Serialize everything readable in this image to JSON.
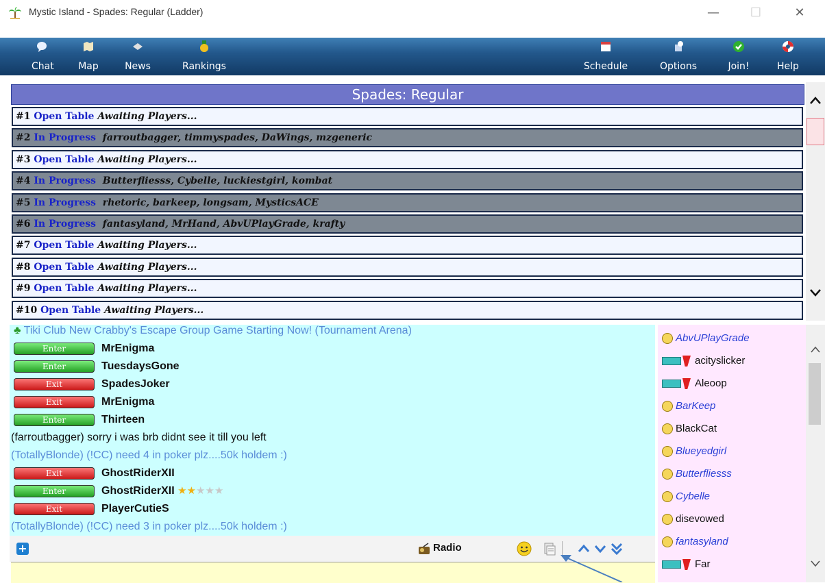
{
  "window": {
    "title": "Mystic Island - Spades: Regular (Ladder)",
    "minimize_glyph": "—",
    "maximize_glyph": "☐",
    "close_glyph": "✕"
  },
  "toolbar": {
    "left_items": [
      {
        "label": "Chat",
        "icon": "chat-bubble-icon"
      },
      {
        "label": "Map",
        "icon": "map-icon"
      },
      {
        "label": "News",
        "icon": "news-icon"
      },
      {
        "label": "Rankings",
        "icon": "medal-icon"
      }
    ],
    "right_items": [
      {
        "label": "Schedule",
        "icon": "calendar-icon"
      },
      {
        "label": "Options",
        "icon": "options-icon"
      },
      {
        "label": "Join!",
        "icon": "check-icon"
      },
      {
        "label": "Help",
        "icon": "lifebuoy-icon"
      }
    ]
  },
  "room": {
    "header": "Spades: Regular",
    "tables": [
      {
        "num": "#1",
        "status": "Open Table",
        "players": "Awaiting Players...",
        "state": "open"
      },
      {
        "num": "#2",
        "status": "In Progress",
        "players": "farroutbagger, timmyspades, DaWings, mzgeneric",
        "state": "prog"
      },
      {
        "num": "#3",
        "status": "Open Table",
        "players": "Awaiting Players...",
        "state": "open"
      },
      {
        "num": "#4",
        "status": "In Progress",
        "players": "Butterfliesss, Cybelle, luckiestgirl, kombat",
        "state": "prog"
      },
      {
        "num": "#5",
        "status": "In Progress",
        "players": "rhetoric, barkeep, longsam, MysticsACE",
        "state": "prog"
      },
      {
        "num": "#6",
        "status": "In Progress",
        "players": "fantasyland, MrHand, AbvUPlayGrade, krafty",
        "state": "prog"
      },
      {
        "num": "#7",
        "status": "Open Table",
        "players": "Awaiting Players...",
        "state": "open"
      },
      {
        "num": "#8",
        "status": "Open Table",
        "players": "Awaiting Players...",
        "state": "open"
      },
      {
        "num": "#9",
        "status": "Open Table",
        "players": "Awaiting Players...",
        "state": "open"
      },
      {
        "num": "#10",
        "status": "Open Table",
        "players": "Awaiting Players...",
        "state": "open"
      }
    ]
  },
  "chat": {
    "announcement": "Tiki Club  New Crabby's Escape Group Game Starting Now! (Tournament Arena)",
    "enter_label": "Enter",
    "exit_label": "Exit",
    "lines": [
      {
        "type": "enter",
        "name": "MrEnigma"
      },
      {
        "type": "enter",
        "name": "TuesdaysGone"
      },
      {
        "type": "exit",
        "name": "SpadesJoker"
      },
      {
        "type": "exit",
        "name": "MrEnigma"
      },
      {
        "type": "enter",
        "name": "Thirteen"
      },
      {
        "type": "msg",
        "text": "(farroutbagger) sorry i was brb didnt see it till you left",
        "color": "dark"
      },
      {
        "type": "msg",
        "text": "(TotallyBlonde) (!CC) need 4 in poker plz....50k holdem :)",
        "color": "blue"
      },
      {
        "type": "exit",
        "name": "GhostRiderXII"
      },
      {
        "type": "enter",
        "name": "GhostRiderXII",
        "stars": 2,
        "stars_total": 5
      },
      {
        "type": "exit",
        "name": "PlayerCutieS"
      },
      {
        "type": "msg",
        "text": "(TotallyBlonde) (!CC) need 3 in poker plz....50k holdem :)",
        "color": "blue"
      }
    ],
    "toolbar": {
      "radio_label": "Radio",
      "plus_glyph": "+"
    },
    "input_value": ""
  },
  "users": [
    {
      "name": "AbvUPlayGrade",
      "style": "italic",
      "icon": "face"
    },
    {
      "name": "acityslicker",
      "style": "normal",
      "icon": "badge"
    },
    {
      "name": "Aleoop",
      "style": "normal",
      "icon": "badge"
    },
    {
      "name": "BarKeep",
      "style": "italic",
      "icon": "face"
    },
    {
      "name": "BlackCat",
      "style": "normal",
      "icon": "face"
    },
    {
      "name": "Blueyedgirl",
      "style": "italic",
      "icon": "face"
    },
    {
      "name": "Butterfliesss",
      "style": "italic",
      "icon": "face"
    },
    {
      "name": "Cybelle",
      "style": "italic",
      "icon": "face"
    },
    {
      "name": "disevowed",
      "style": "normal",
      "icon": "face"
    },
    {
      "name": "fantasyland",
      "style": "italic",
      "icon": "face"
    },
    {
      "name": "Far",
      "style": "normal",
      "icon": "badge"
    }
  ],
  "colors": {
    "header_bg": "#6f75c9",
    "status_link": "#1a24c8",
    "chat_bg": "#ccffff",
    "userlist_bg": "#ffe8ff",
    "input_bg": "#ffffcc",
    "annotation_arrow": "#4a7fc0"
  }
}
